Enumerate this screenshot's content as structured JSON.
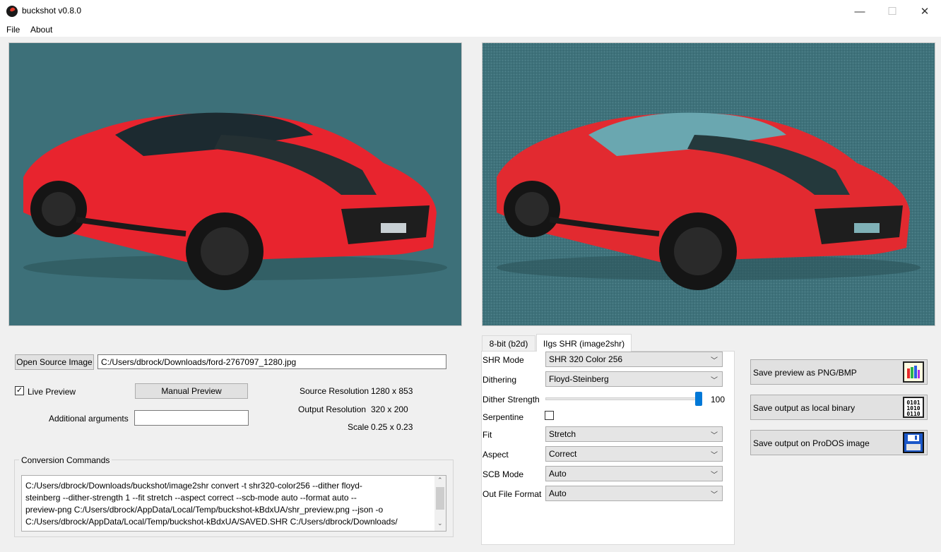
{
  "window": {
    "title": "buckshot  v0.8.0",
    "minimize": "—",
    "maximize": "☐",
    "close": "✕"
  },
  "menu": [
    "File",
    "About"
  ],
  "source": {
    "open_button": "Open Source Image",
    "path": "C:/Users/dbrock/Downloads/ford-2767097_1280.jpg",
    "live_preview_label": "Live Preview",
    "live_preview_checked": true,
    "manual_preview_button": "Manual Preview",
    "additional_args_label": "Additional arguments",
    "additional_args_value": ""
  },
  "info": {
    "source_resolution_label": "Source Resolution",
    "source_resolution": "1280 x 853",
    "output_resolution_label": "Output Resolution",
    "output_resolution": "320 x 200",
    "scale_label": "Scale",
    "scale": "0.25 x 0.23"
  },
  "conversion": {
    "title": "Conversion Commands",
    "lines": [
      "C:/Users/dbrock/Downloads/buckshot/image2shr convert -t shr320-color256 --dither floyd-",
      "steinberg --dither-strength 1 --fit stretch --aspect correct --scb-mode auto --format auto --",
      "preview-png C:/Users/dbrock/AppData/Local/Temp/buckshot-kBdxUA/shr_preview.png --json -o",
      "C:/Users/dbrock/AppData/Local/Temp/buckshot-kBdxUA/SAVED.SHR C:/Users/dbrock/Downloads/"
    ]
  },
  "tabs": [
    "8-bit (b2d)",
    "IIgs SHR (image2shr)"
  ],
  "active_tab": 1,
  "settings": {
    "shr_mode_label": "SHR Mode",
    "shr_mode": "SHR 320 Color 256",
    "dithering_label": "Dithering",
    "dithering": "Floyd-Steinberg",
    "dither_strength_label": "Dither Strength",
    "dither_strength": "100",
    "dither_strength_fraction": 1.0,
    "serpentine_label": "Serpentine",
    "serpentine_checked": false,
    "fit_label": "Fit",
    "fit": "Stretch",
    "aspect_label": "Aspect",
    "aspect": "Correct",
    "scb_mode_label": "SCB Mode",
    "scb_mode": "Auto",
    "out_format_label": "Out File Format",
    "out_format": "Auto"
  },
  "save": {
    "preview_label": "Save preview as PNG/BMP",
    "binary_label": "Save output as local binary",
    "prodos_label": "Save output on ProDOS image"
  },
  "colors": {
    "image_background": "#3d7079",
    "car_red": "#e8242e",
    "accent": "#0078d7"
  }
}
